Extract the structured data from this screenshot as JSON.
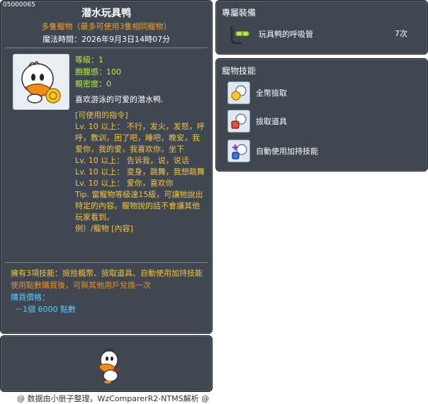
{
  "item": {
    "id": "05000065",
    "title": "潜水玩具鸭",
    "subtitle": "多隻寵物（最多可使用3隻相同寵物）",
    "magic_time": "魔法時間：2026年9月3日14時07分"
  },
  "stats": {
    "level": "等級：1",
    "fullness": "飽腹感：100",
    "intimacy": "親密度：0"
  },
  "description": {
    "intro": "喜欢游泳的可爱的潜水鸭.",
    "commands_header": "[可使用的指令]",
    "cmd1": "Lv. 10 以上： 不行，发火，发怒，呼呼，教训，困了吧，睡吧，晚安，我爱你，我的爱，我喜欢你，坐下",
    "cmd2": "Lv. 10 以上： 告诉我，说，说话",
    "cmd3": "Lv. 10 以上： 变身，跳舞，我想跳舞",
    "cmd4": "Lv. 10 以上： 爱你，喜欢你",
    "tip": "Tip. 當寵物等級達15級，可讓牠說出特定的內容。寵物說的話不會讓其他玩家看到。",
    "example": "例）/寵物 [內容]"
  },
  "footer": {
    "skills_line": "擁有3項技能：撿拾楓幣、撿取道具、自動使用加持技能",
    "trade_line": "使用點數購買後，可與其他用戶兌換一次",
    "price_label": "購買價格：",
    "price_value": "－1個 6000 點數"
  },
  "exclusive": {
    "title": "專屬裝備",
    "item_name": "玩具鸭的呼吸管",
    "item_count": "7次"
  },
  "pet_skills": {
    "title": "寵物技能",
    "skills": [
      {
        "label": "全幣撿取",
        "icon": "coin-pickup-icon"
      },
      {
        "label": "撿取道具",
        "icon": "item-pickup-icon"
      },
      {
        "label": "自動使用加持技能",
        "icon": "auto-buff-icon"
      }
    ]
  },
  "credit": "@ 数据由小册子整理，WzComparerR2-NTMS解析 @",
  "colors": {
    "panel_bg": "#3f4852",
    "orange": "#f5a020",
    "green_stat": "#b8f03a",
    "yellow": "#f5c343",
    "blue": "#5ec7ff"
  }
}
